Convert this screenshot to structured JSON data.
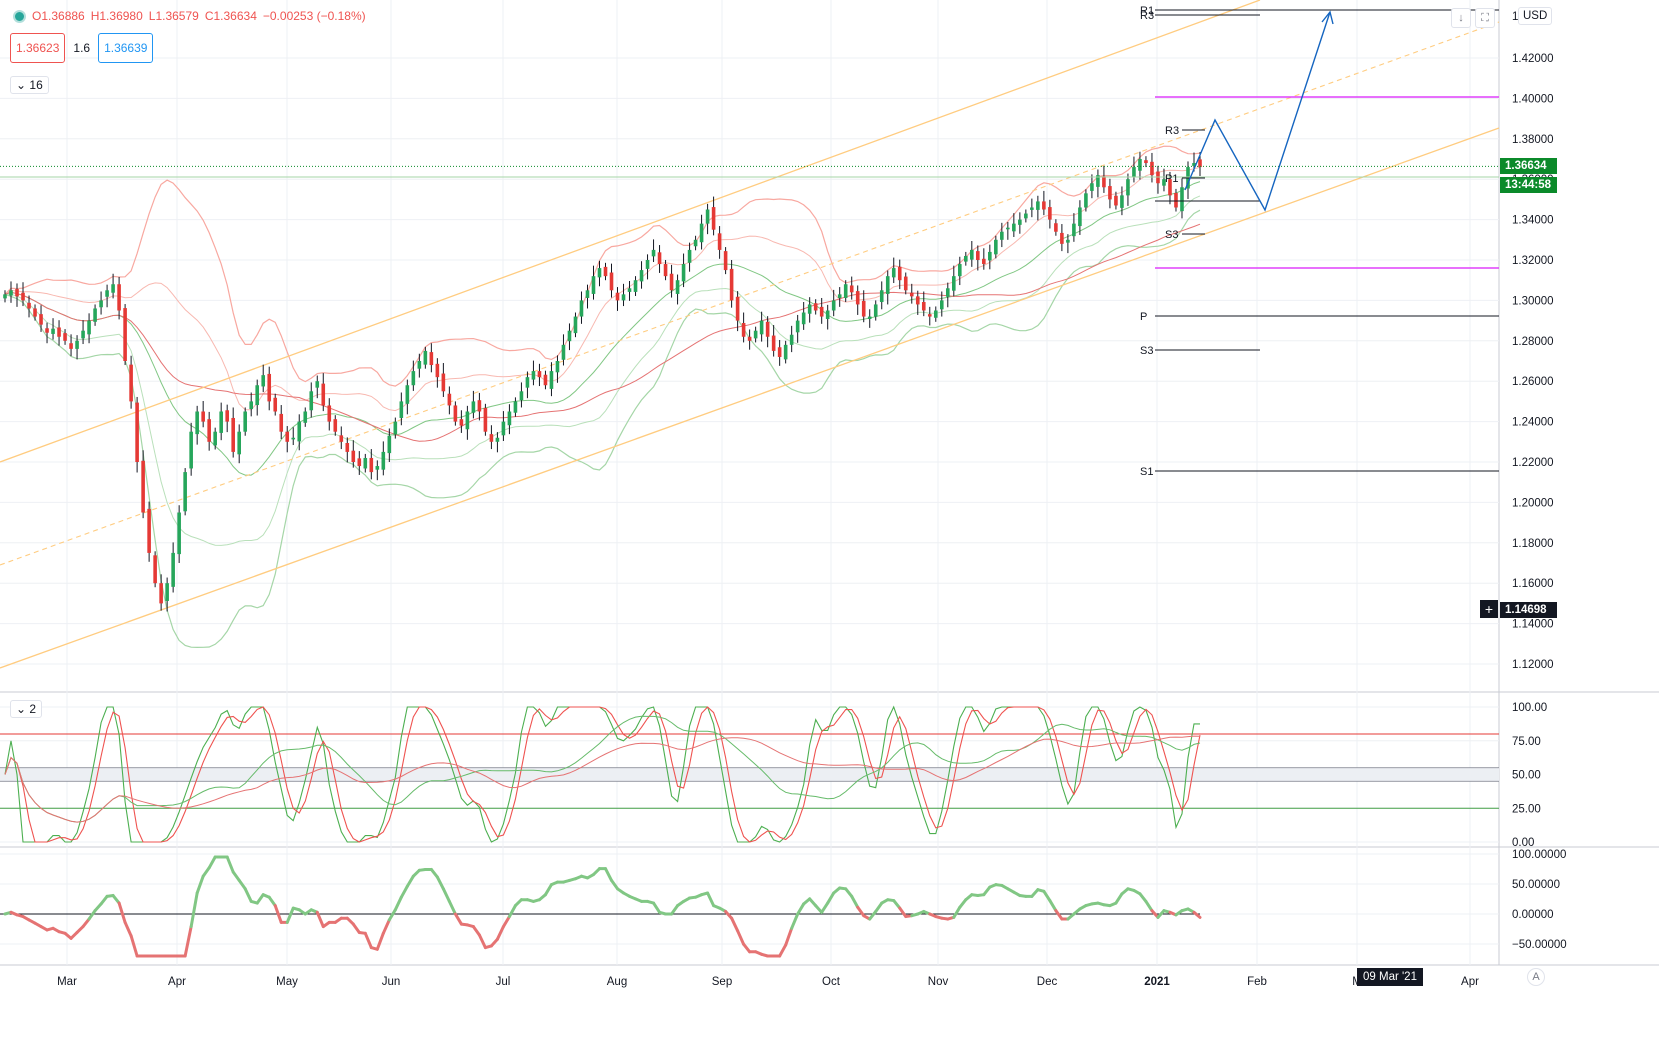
{
  "ohlc": {
    "open": "O1.36886",
    "high": "H1.36980",
    "low": "L1.36579",
    "close": "C1.36634",
    "change": "−0.00253 (−0.18%)"
  },
  "bid_ask": {
    "sell": "1.36623",
    "spread": "1.6",
    "buy": "1.36639"
  },
  "main_pane_collapse": "16",
  "osc_pane_collapse": "2",
  "currency": "USD",
  "last_price": "1.36634",
  "countdown": "13:44:58",
  "crosshair_price": "1.14698",
  "crosshair_date": "09 Mar '21",
  "auto_label": "A",
  "colors": {
    "up": "#26a65b",
    "down": "#e53935",
    "channel": "#ffcc80",
    "pivot_magenta": "#e040fb",
    "forecast": "#1565c0",
    "stoch_k": "#4caf50",
    "stoch_d": "#ef5350",
    "badge_green": "#0b8a2a"
  },
  "price_axis": [
    "1.4",
    "1.42000",
    "1.40000",
    "1.38000",
    "1.36000",
    "1.34000",
    "1.32000",
    "1.30000",
    "1.28000",
    "1.26000",
    "1.24000",
    "1.22000",
    "1.20000",
    "1.18000",
    "1.16000",
    "1.14000",
    "1.12000"
  ],
  "osc_axis": [
    "100.00",
    "75.00",
    "50.00",
    "25.00",
    "0.00"
  ],
  "mom_axis": [
    "100.00000",
    "50.00000",
    "0.00000",
    "−50.00000"
  ],
  "months": [
    "Mar",
    "Apr",
    "May",
    "Jun",
    "Jul",
    "Aug",
    "Sep",
    "Oct",
    "Nov",
    "Dec",
    "2021",
    "Feb",
    "M",
    "Apr"
  ],
  "pivot_labels": {
    "r_top": "R1",
    "r3_top": "R3",
    "r3": "R3",
    "p1": "P1",
    "s3_upper": "S3",
    "p": "P",
    "s3_lower": "S3",
    "s1": "S1"
  },
  "chart_data": {
    "type": "candlestick",
    "instrument_last": 1.36634,
    "ylim": [
      1.1,
      1.44
    ],
    "osc_ylim": [
      0,
      100
    ],
    "mom_ylim": [
      -75,
      100
    ],
    "closes": [
      1.303,
      1.305,
      1.302,
      1.3,
      1.296,
      1.292,
      1.288,
      1.284,
      1.286,
      1.282,
      1.28,
      1.276,
      1.28,
      1.285,
      1.29,
      1.296,
      1.3,
      1.305,
      1.308,
      1.295,
      1.27,
      1.25,
      1.22,
      1.195,
      1.175,
      1.16,
      1.15,
      1.16,
      1.175,
      1.195,
      1.215,
      1.235,
      1.245,
      1.24,
      1.23,
      1.235,
      1.245,
      1.24,
      1.225,
      1.235,
      1.245,
      1.25,
      1.258,
      1.263,
      1.25,
      1.245,
      1.235,
      1.23,
      1.232,
      1.24,
      1.245,
      1.255,
      1.26,
      1.248,
      1.24,
      1.235,
      1.23,
      1.225,
      1.22,
      1.218,
      1.222,
      1.215,
      1.218,
      1.225,
      1.233,
      1.24,
      1.25,
      1.258,
      1.265,
      1.27,
      1.275,
      1.268,
      1.262,
      1.255,
      1.248,
      1.24,
      1.238,
      1.245,
      1.25,
      1.245,
      1.235,
      1.23,
      1.232,
      1.24,
      1.245,
      1.25,
      1.255,
      1.262,
      1.265,
      1.262,
      1.258,
      1.265,
      1.27,
      1.278,
      1.285,
      1.292,
      1.3,
      1.305,
      1.312,
      1.316,
      1.312,
      1.305,
      1.3,
      1.303,
      1.306,
      1.31,
      1.315,
      1.32,
      1.325,
      1.318,
      1.312,
      1.305,
      1.31,
      1.318,
      1.325,
      1.33,
      1.338,
      1.345,
      1.335,
      1.325,
      1.315,
      1.3,
      1.29,
      1.282,
      1.28,
      1.285,
      1.29,
      1.282,
      1.275,
      1.272,
      1.278,
      1.283,
      1.29,
      1.294,
      1.298,
      1.295,
      1.292,
      1.295,
      1.3,
      1.303,
      1.308,
      1.304,
      1.298,
      1.292,
      1.292,
      1.298,
      1.305,
      1.312,
      1.316,
      1.31,
      1.305,
      1.302,
      1.298,
      1.295,
      1.292,
      1.295,
      1.3,
      1.306,
      1.312,
      1.318,
      1.322,
      1.325,
      1.32,
      1.318,
      1.324,
      1.33,
      1.334,
      1.336,
      1.338,
      1.34,
      1.343,
      1.346,
      1.349,
      1.345,
      1.34,
      1.334,
      1.328,
      1.33,
      1.338,
      1.346,
      1.353,
      1.358,
      1.362,
      1.356,
      1.35,
      1.347,
      1.352,
      1.36,
      1.366,
      1.37,
      1.368,
      1.362,
      1.358,
      1.36,
      1.352,
      1.346,
      1.356,
      1.366,
      1.368,
      1.366
    ]
  }
}
